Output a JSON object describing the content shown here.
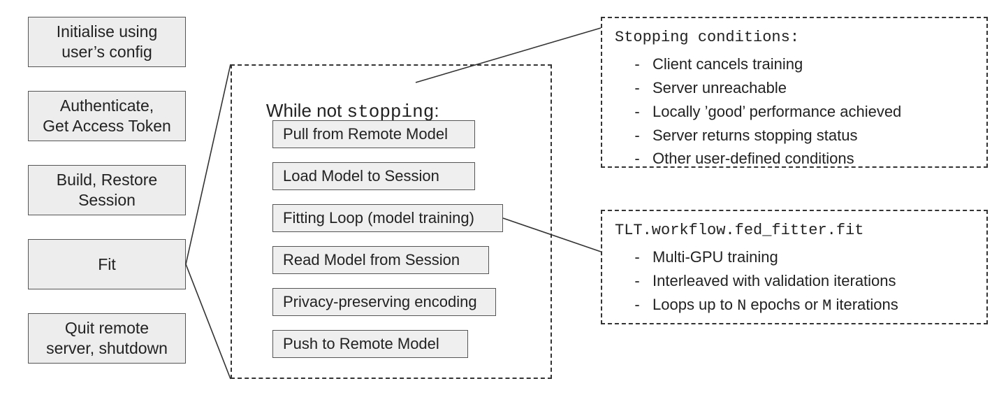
{
  "left_steps": [
    {
      "label": "Initialise using\nuser's config"
    },
    {
      "label": "Authenticate,\nGet Access Token"
    },
    {
      "label": "Build, Restore\nSession"
    },
    {
      "label": "Fit"
    },
    {
      "label": "Quit remote\nserver, shutdown"
    }
  ],
  "loop": {
    "title_prefix": "While not ",
    "title_mono": "stopping",
    "title_suffix": ":",
    "steps": [
      "Pull from Remote Model",
      "Load Model to Session",
      "Fitting Loop (model training)",
      "Read Model from Session",
      "Privacy-preserving encoding",
      "Push to Remote Model"
    ]
  },
  "stopping": {
    "title": "Stopping conditions:",
    "items": [
      "Client cancels training",
      "Server unreachable",
      "Locally 'good' performance achieved",
      "Server returns stopping status",
      "Other user-defined conditions"
    ]
  },
  "fit": {
    "title_mono": "TLT.workflow.fed_fitter.fit",
    "items": [
      {
        "text": "Multi-GPU training"
      },
      {
        "text": "Interleaved with validation iterations"
      },
      {
        "html": "Loops up to <span class='mono'>N</span> epochs or <span class='mono'>M</span> iterations"
      }
    ]
  }
}
